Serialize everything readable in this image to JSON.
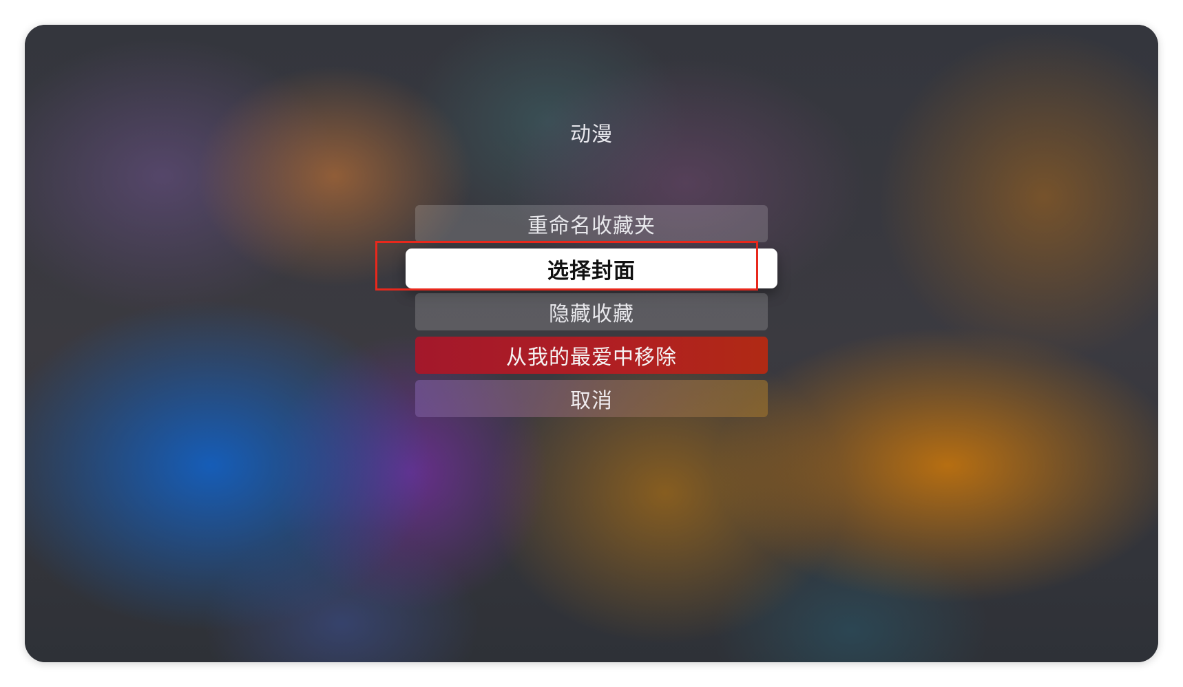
{
  "collection": {
    "title": "动漫"
  },
  "action_menu": {
    "items": [
      {
        "label": "重命名收藏夹"
      },
      {
        "label": "选择封面"
      },
      {
        "label": "隐藏收藏"
      },
      {
        "label": "从我的最爱中移除"
      },
      {
        "label": "取消"
      }
    ],
    "focused_index": 1
  },
  "colors": {
    "focus_outline": "#e8281c",
    "destructive": "#b11f22",
    "focused_bg": "#ffffff"
  }
}
